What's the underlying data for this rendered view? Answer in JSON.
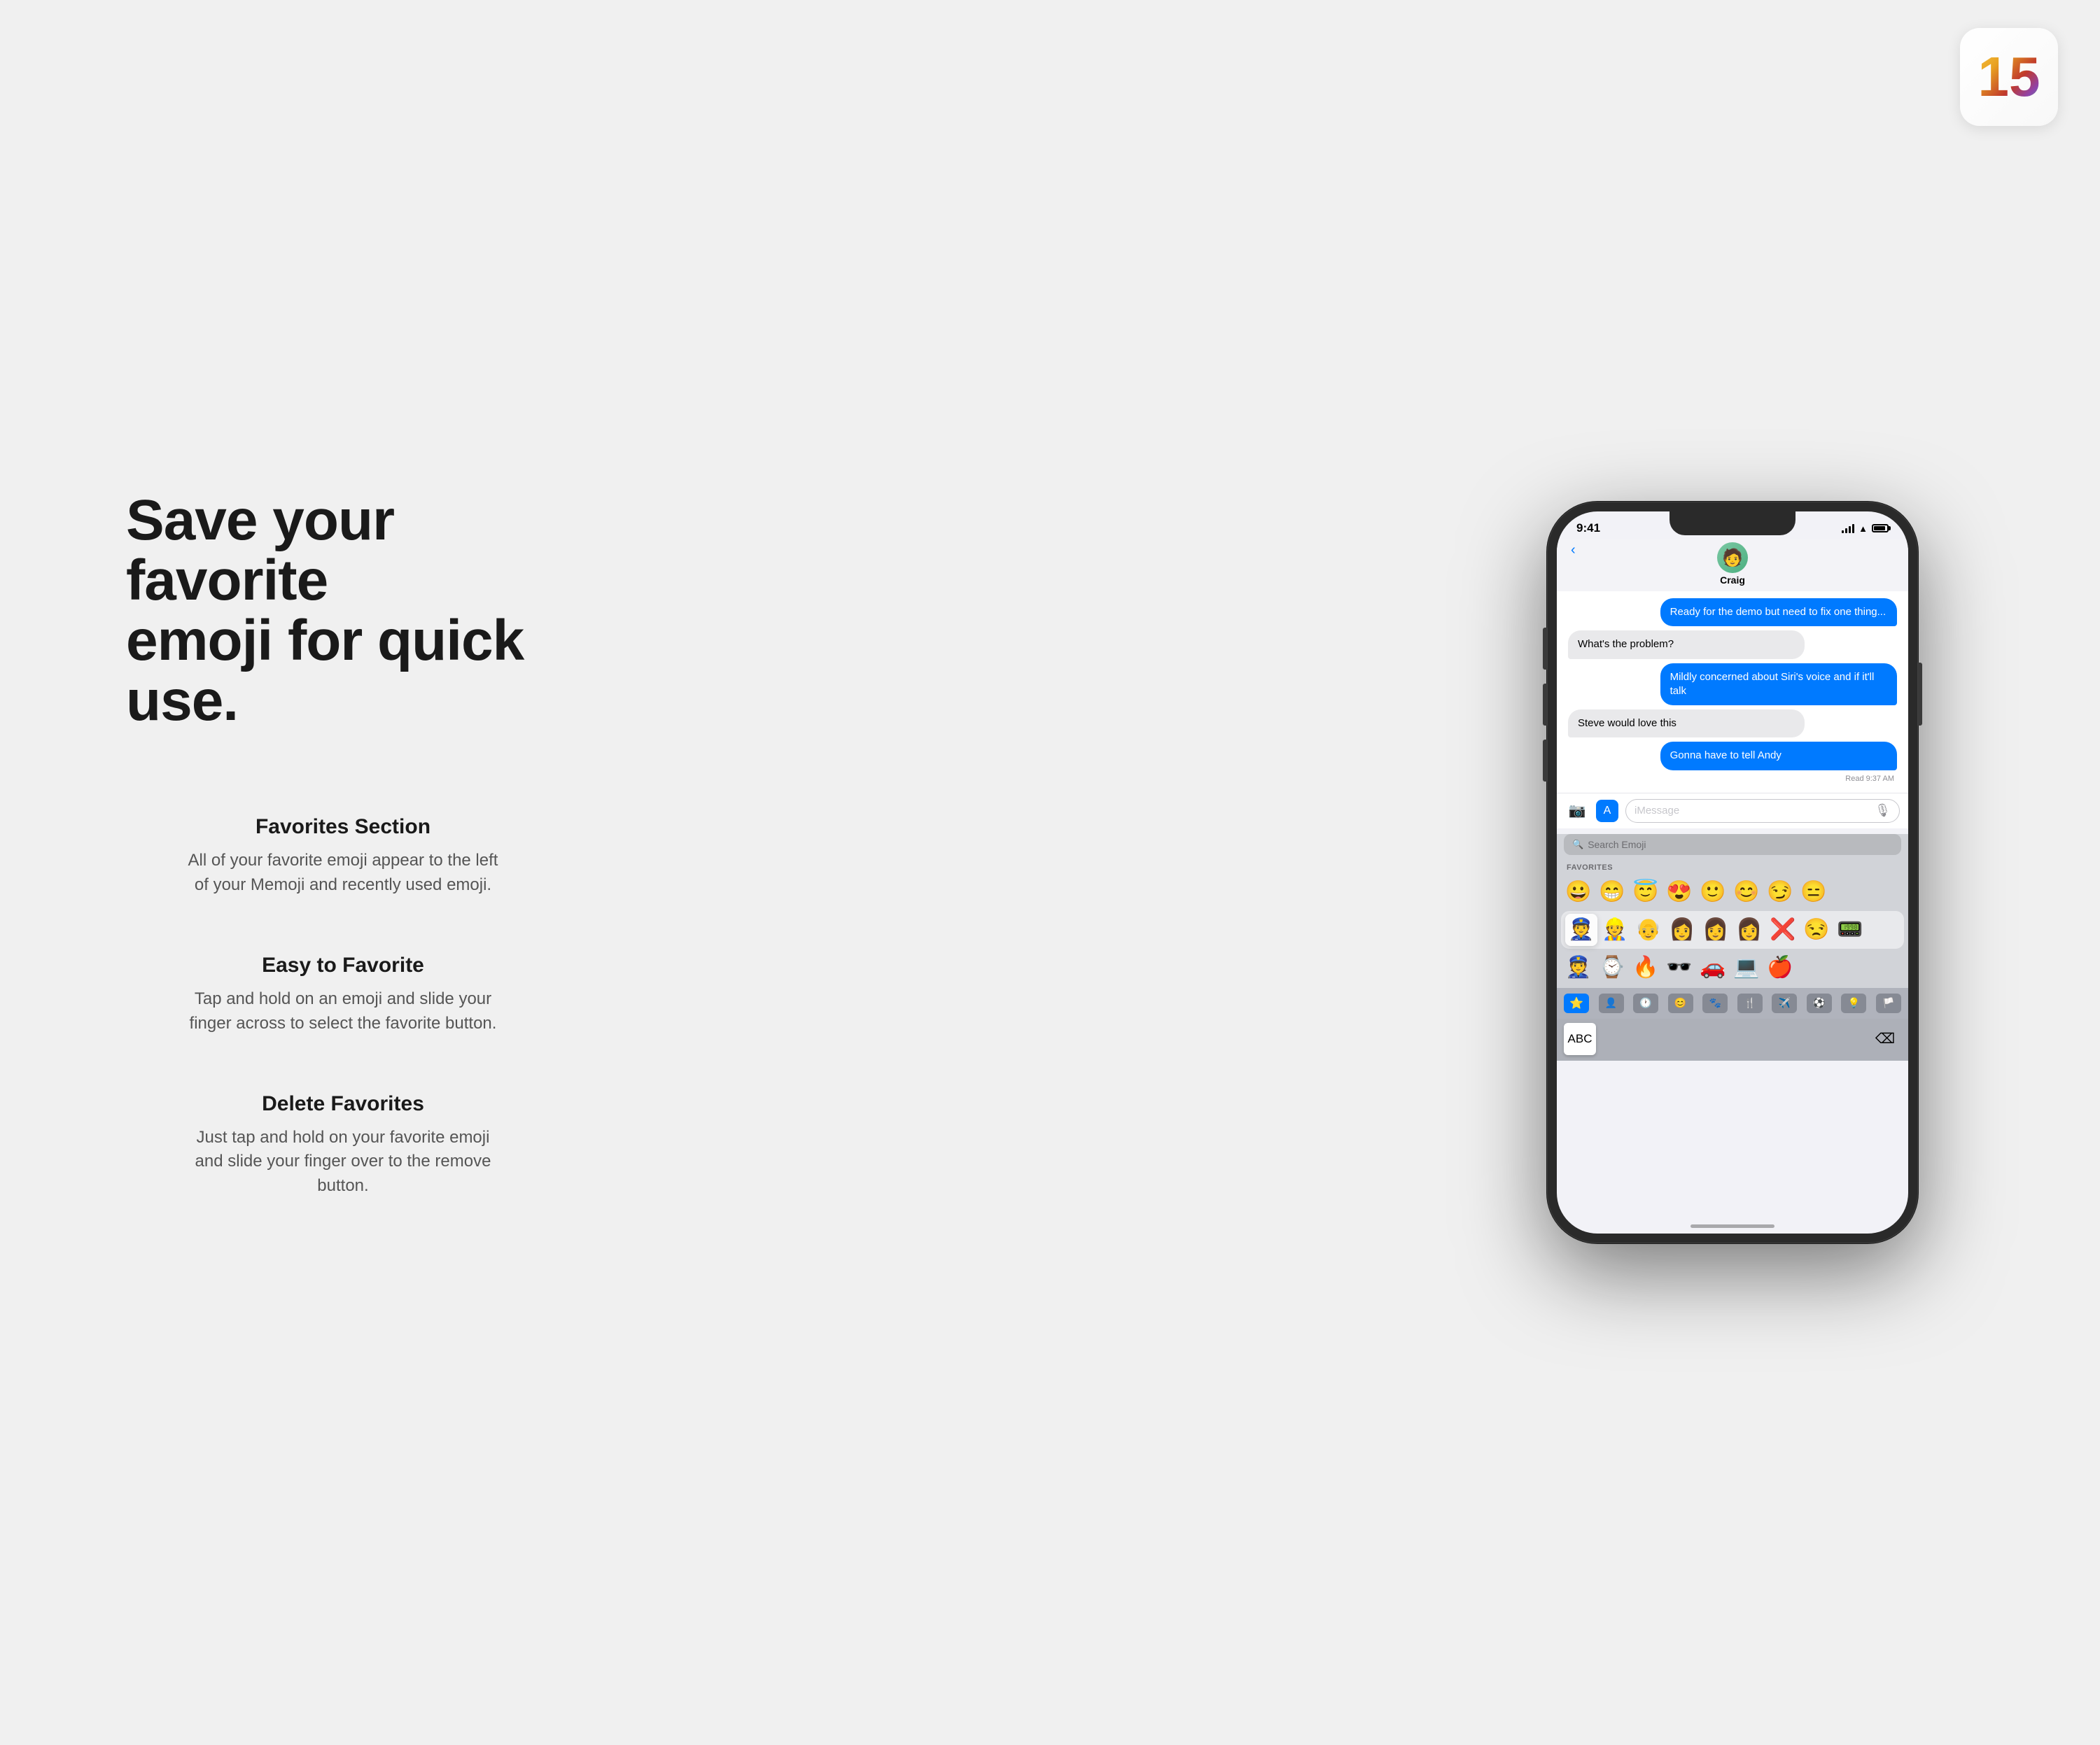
{
  "badge": {
    "number": "15"
  },
  "left": {
    "heading_line1": "Save your favorite",
    "heading_line2": "emoji for quick use.",
    "features": [
      {
        "title": "Favorites Section",
        "description": "All of your favorite emoji appear to the left of your Memoji and recently used emoji."
      },
      {
        "title": "Easy to Favorite",
        "description": "Tap and hold on an emoji and slide your finger across to select the favorite button."
      },
      {
        "title": "Delete Favorites",
        "description": "Just tap and hold on your favorite emoji and slide your finger over to the remove button."
      }
    ]
  },
  "phone": {
    "status": {
      "time": "9:41"
    },
    "contact": {
      "name": "Craig",
      "avatar_emoji": "🧑"
    },
    "messages": [
      {
        "type": "sent",
        "text": "Ready for the demo but need to fix one thing..."
      },
      {
        "type": "received",
        "text": "What's the problem?"
      },
      {
        "type": "sent",
        "text": "Mildly concerned about Siri's voice and if it'll talk"
      },
      {
        "type": "received",
        "text": "Steve would love this"
      },
      {
        "type": "sent",
        "text": "Gonna have to tell Andy"
      }
    ],
    "read_receipt": "Read 9:37 AM",
    "input_placeholder": "iMessage",
    "emoji_search_placeholder": "Search Emoji",
    "favorites_label": "FAVORITES",
    "emojis_row1": [
      "😀",
      "😁",
      "😇",
      "😍",
      "🙂",
      "😊",
      "😏",
      "😑"
    ],
    "emojis_row2": [
      "👮",
      "👷",
      "👴",
      "👩",
      "👩",
      "👩",
      "❌",
      "😒",
      "📟"
    ],
    "emojis_row3": [
      "👮",
      "⌚",
      "🔥",
      "🕶️",
      "🚗",
      "💻",
      "🍎"
    ],
    "keyboard_abc": "ABC"
  }
}
